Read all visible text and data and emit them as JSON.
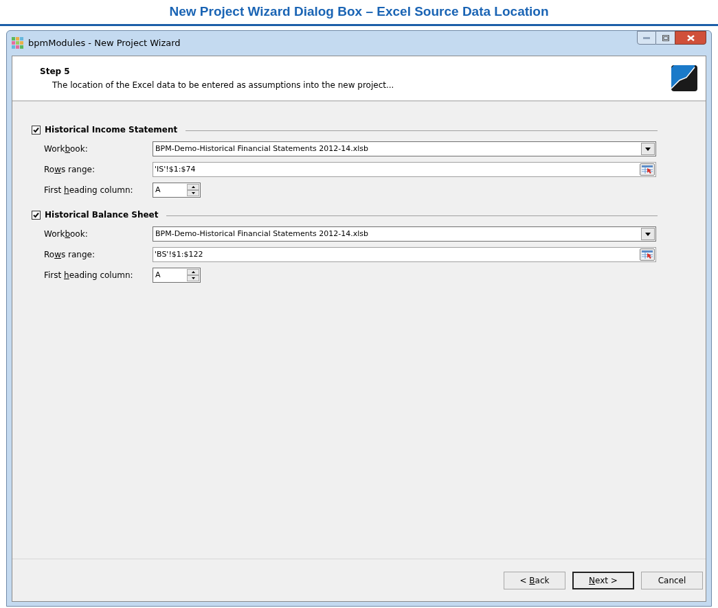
{
  "page_title": "New Project Wizard Dialog Box – Excel Source Data Location",
  "window": {
    "title": "bpmModules - New Project Wizard"
  },
  "header": {
    "step": "Step 5",
    "description": "The location of the Excel data to be entered as assumptions into the new project..."
  },
  "sections": [
    {
      "title": "Historical Income Statement",
      "checked": true,
      "workbook_label": [
        "Work",
        "b",
        "ook:"
      ],
      "workbook": "BPM-Demo-Historical Financial Statements 2012-14.xlsb",
      "rows_label": [
        "Ro",
        "w",
        "s range:"
      ],
      "rows_range": "'IS'!$1:$74",
      "heading_label": [
        "First ",
        "h",
        "eading column:"
      ],
      "heading_column": "A"
    },
    {
      "title": "Historical Balance Sheet",
      "checked": true,
      "workbook_label": [
        "Work",
        "b",
        "ook:"
      ],
      "workbook": "BPM-Demo-Historical Financial Statements 2012-14.xlsb",
      "rows_label": [
        "Ro",
        "w",
        "s range:"
      ],
      "rows_range": "'BS'!$1:$122",
      "heading_label": [
        "First ",
        "h",
        "eading column:"
      ],
      "heading_column": "A"
    }
  ],
  "buttons": [
    {
      "label": {
        "before": "< ",
        "key": "B",
        "after": "ack"
      },
      "default": false
    },
    {
      "label": {
        "key": "N",
        "after": "ext >"
      },
      "default": true
    },
    {
      "label": {
        "before": "Cancel"
      },
      "default": false
    }
  ]
}
